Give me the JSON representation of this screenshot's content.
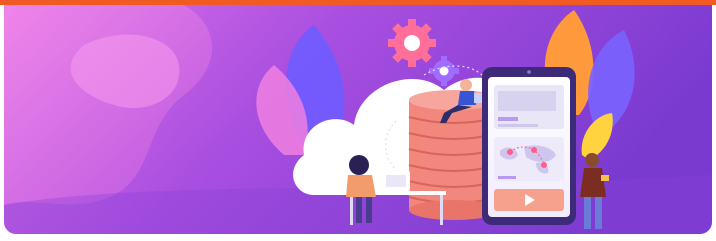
{
  "colors": {
    "accent_bar": "#f15a22",
    "banner_start": "#d86be8",
    "banner_end": "#7b3bd2",
    "database": "#f2877d",
    "gear_pink": "#ff6f9a",
    "gear_purple": "#9f6cff",
    "phone_body": "#3d2a78",
    "leaf_orange": "#ff9a3c",
    "leaf_blue": "#7a63ff"
  },
  "illustration": {
    "subject": "cloud-storage-illustration",
    "icons": [
      "gear-icon",
      "database-icon",
      "cloud-icon",
      "smartphone-icon",
      "world-map-icon",
      "map-pin-icon",
      "play-icon",
      "laptop-icon"
    ]
  }
}
